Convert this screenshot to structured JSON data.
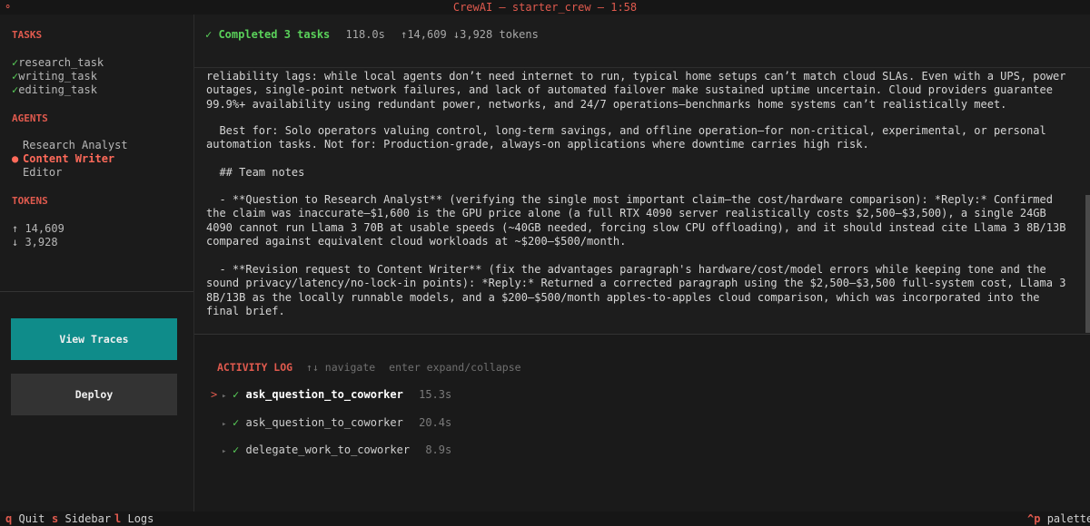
{
  "window": {
    "title": "CrewAI — starter_crew — 1:58",
    "menu_glyph": "⚬"
  },
  "sidebar": {
    "tasks_heading": "TASKS",
    "tasks": [
      {
        "check": "✓",
        "label": "research_task"
      },
      {
        "check": "✓",
        "label": "writing_task"
      },
      {
        "check": "✓",
        "label": "editing_task"
      }
    ],
    "agents_heading": "AGENTS",
    "agents": [
      {
        "marker": "",
        "label": "Research Analyst",
        "active": false
      },
      {
        "marker": "●",
        "label": "Content Writer",
        "active": true
      },
      {
        "marker": "",
        "label": "Editor",
        "active": false
      }
    ],
    "tokens_heading": "TOKENS",
    "tokens_in": "↑ 14,609",
    "tokens_out": "↓ 3,928",
    "view_traces_label": "View Traces",
    "deploy_label": "Deploy"
  },
  "header": {
    "status": "✓ Completed 3 tasks",
    "duration": "118.0s",
    "tokens": "↑14,609 ↓3,928 tokens"
  },
  "content": {
    "paragraphs": [
      "reliability lags: while local agents don’t need internet to run, typical home setups can’t match cloud SLAs. Even with a UPS, power outages, single-point network failures, and lack of automated failover make sustained uptime uncertain. Cloud providers guarantee 99.9%+ availability using redundant power, networks, and 24/7 operations—benchmarks home systems can’t realistically meet.",
      "  Best for: Solo operators valuing control, long-term savings, and offline operation—for non-critical, experimental, or personal automation tasks. Not for: Production-grade, always-on applications where downtime carries high risk.",
      "  ## Team notes",
      "  - **Question to Research Analyst** (verifying the single most important claim—the cost/hardware comparison): *Reply:* Confirmed the claim was inaccurate—$1,600 is the GPU price alone (a full RTX 4090 server realistically costs $2,500–$3,500), a single 24GB 4090 cannot run Llama 3 70B at usable speeds (~40GB needed, forcing slow CPU offloading), and it should instead cite Llama 3 8B/13B compared against equivalent cloud workloads at ~$200–$500/month.",
      "  - **Revision request to Content Writer** (fix the advantages paragraph's hardware/cost/model errors while keeping tone and the sound privacy/latency/no-lock-in points): *Reply:* Returned a corrected paragraph using the $2,500–$3,500 full-system cost, Llama 3 8B/13B as the locally runnable models, and a $200–$500/month apples-to-apples cloud comparison, which was incorporated into the final brief."
    ]
  },
  "activity_log": {
    "heading": "ACTIVITY LOG",
    "hint_navigate": "↑↓ navigate",
    "hint_expand": "enter expand/collapse",
    "entries": [
      {
        "cursor": ">",
        "tri": "▸",
        "check": "✓",
        "name": "ask_question_to_coworker",
        "time": "15.3s",
        "selected": true
      },
      {
        "cursor": "",
        "tri": "▸",
        "check": "✓",
        "name": "ask_question_to_coworker",
        "time": "20.4s",
        "selected": false
      },
      {
        "cursor": "",
        "tri": "▸",
        "check": "✓",
        "name": "delegate_work_to_coworker",
        "time": "8.9s",
        "selected": false
      }
    ]
  },
  "footer": {
    "quit_key": "q",
    "quit_label": "Quit",
    "sidebar_key": "s",
    "sidebar_label": "Sidebar",
    "logs_key": "l",
    "logs_label": "Logs",
    "palette_key": "^p",
    "palette_label": "palette"
  }
}
